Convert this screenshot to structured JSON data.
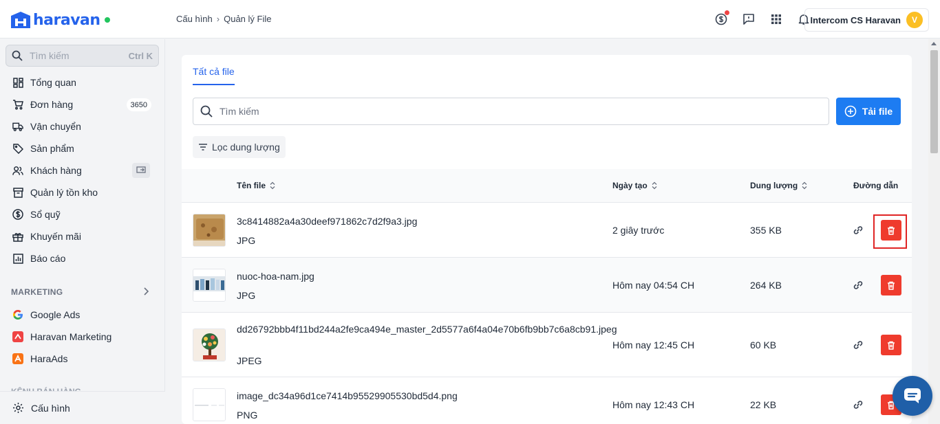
{
  "brand": {
    "name": "haravan",
    "color": "#2563eb"
  },
  "breadcrumb": {
    "parent": "Cấu hình",
    "current": "Quản lý File"
  },
  "header": {
    "account_name": "Intercom CS Haravan",
    "avatar_initial": "V"
  },
  "sidebar": {
    "search_placeholder": "Tìm kiếm",
    "search_shortcut": "Ctrl K",
    "items": [
      {
        "label": "Tổng quan",
        "icon": "dashboard-icon"
      },
      {
        "label": "Đơn hàng",
        "icon": "cart-icon",
        "badge": "3650"
      },
      {
        "label": "Vận chuyển",
        "icon": "truck-icon"
      },
      {
        "label": "Sản phẩm",
        "icon": "tag-icon"
      },
      {
        "label": "Khách hàng",
        "icon": "users-icon"
      },
      {
        "label": "Quản lý tồn kho",
        "icon": "inventory-icon"
      },
      {
        "label": "Sổ quỹ",
        "icon": "dollar-icon"
      },
      {
        "label": "Khuyến mãi",
        "icon": "gift-icon"
      },
      {
        "label": "Báo cáo",
        "icon": "chart-icon"
      }
    ],
    "marketing_label": "MARKETING",
    "marketing_items": [
      {
        "label": "Google Ads",
        "icon": "google-icon"
      },
      {
        "label": "Haravan Marketing",
        "icon": "haravan-marketing-icon"
      },
      {
        "label": "HaraAds",
        "icon": "haraads-icon"
      }
    ],
    "sales_channel_label": "KÊNH BÁN HÀNG",
    "settings_label": "Cấu hình"
  },
  "main": {
    "tab_label": "Tất cả file",
    "search_placeholder": "Tìm kiếm",
    "upload_label": "Tải file",
    "filter_label": "Lọc dung lượng",
    "columns": {
      "name": "Tên file",
      "date": "Ngày tạo",
      "size": "Dung lượng",
      "link": "Đường dẫn"
    },
    "files": [
      {
        "name": "3c8414882a4a30deef971862c7d2f9a3.jpg",
        "type": "JPG",
        "date": "2 giây trước",
        "size": "355 KB"
      },
      {
        "name": "nuoc-hoa-nam.jpg",
        "type": "JPG",
        "date": "Hôm nay 04:54 CH",
        "size": "264 KB"
      },
      {
        "name": "dd26792bbb4f11bd244a2fe9ca494e_master_2d5577a6f4a04e70b6fb9bb7c6a8cb91.jpeg",
        "type": "JPEG",
        "date": "Hôm nay 12:45 CH",
        "size": "60 KB"
      },
      {
        "name": "image_dc34a96d1ce7414b95529905530bd5d4.png",
        "type": "PNG",
        "date": "Hôm nay 12:43 CH",
        "size": "22 KB"
      }
    ]
  },
  "colors": {
    "primary": "#1d7cf2",
    "danger": "#ef3b2d",
    "highlight": "#e02424"
  }
}
